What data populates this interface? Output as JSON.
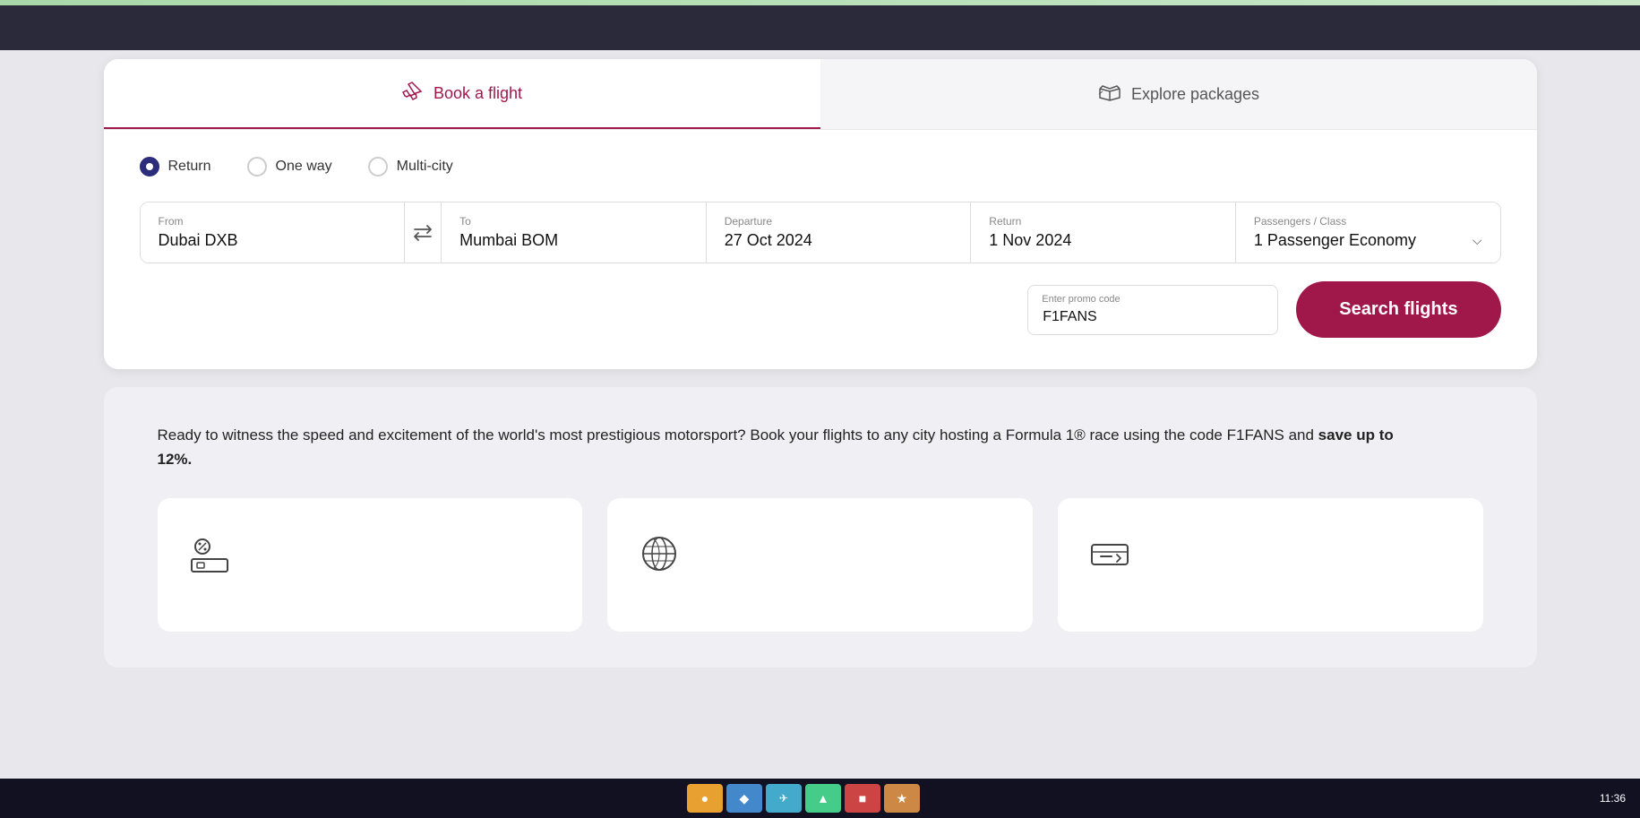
{
  "topbar": {
    "accent_color": "#a8d8a8"
  },
  "tabs": {
    "book_flight": {
      "label": "Book a flight",
      "active": true
    },
    "explore_packages": {
      "label": "Explore packages",
      "active": false
    }
  },
  "trip_types": [
    {
      "id": "return",
      "label": "Return",
      "selected": true
    },
    {
      "id": "one_way",
      "label": "One way",
      "selected": false
    },
    {
      "id": "multi_city",
      "label": "Multi-city",
      "selected": false
    }
  ],
  "fields": {
    "from": {
      "label": "From",
      "value": "Dubai DXB"
    },
    "to": {
      "label": "To",
      "value": "Mumbai BOM"
    },
    "departure": {
      "label": "Departure",
      "value": "27 Oct 2024"
    },
    "return": {
      "label": "Return",
      "value": "1 Nov 2024"
    },
    "passengers": {
      "label": "Passengers / Class",
      "value": "1  Passenger Economy"
    }
  },
  "promo": {
    "label": "Enter promo code",
    "value": "F1FANS"
  },
  "search_button": {
    "label": "Search flights"
  },
  "promo_section": {
    "text_part1": "Ready to witness the speed and excitement of the world's most prestigious motorsport? Book your flights to any city hosting a Formula 1® race using the code F1FANS and ",
    "text_bold": "save up to 12%.",
    "cards": [
      {
        "id": "discount",
        "icon": "🏷️"
      },
      {
        "id": "globe",
        "icon": "🌐"
      },
      {
        "id": "ticket",
        "icon": "🎫"
      }
    ]
  },
  "taskbar": {
    "time": "11:36"
  }
}
